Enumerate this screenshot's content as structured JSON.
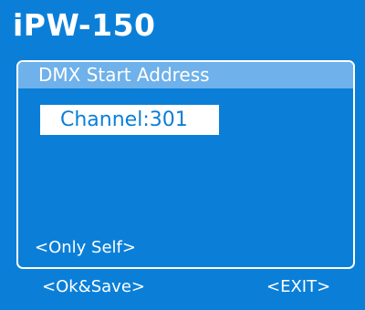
{
  "device": {
    "title": "iPW-150"
  },
  "menu": {
    "header": "DMX Start Address",
    "channel_label": "Channel:",
    "channel_value": "301",
    "mode_hint": "<Only Self>"
  },
  "footer": {
    "ok_save_label": "<Ok&Save>",
    "exit_label": "<EXIT>"
  },
  "colors": {
    "background": "#0b7fd8",
    "header_highlight": "#6fb1ea",
    "foreground": "#ffffff"
  }
}
